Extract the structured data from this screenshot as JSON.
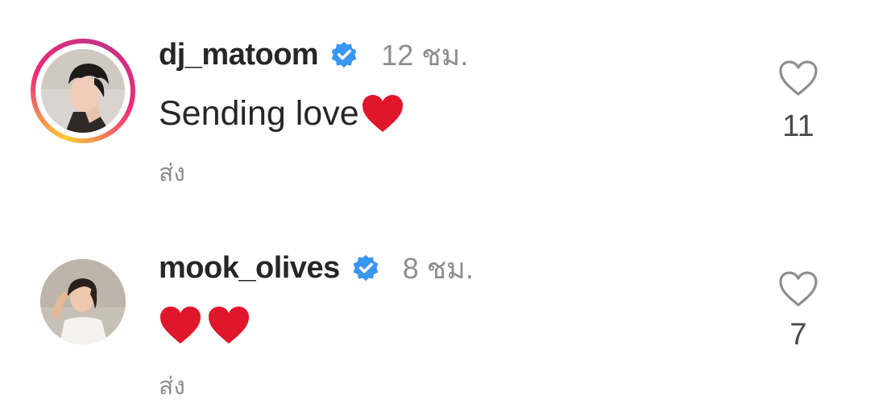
{
  "comments": [
    {
      "username": "dj_matoom",
      "time": "12 ชม.",
      "text": "Sending love",
      "reply_label": "ส่ง",
      "likes": "11",
      "avatar_icon": "user-avatar-story-ring"
    },
    {
      "username": "mook_olives",
      "time": "8 ชม.",
      "text": "",
      "reply_label": "ส่ง",
      "likes": "7",
      "avatar_icon": "user-avatar"
    }
  ],
  "colors": {
    "verified": "#3897f0",
    "heart_emoji": "#e0162b",
    "muted_text": "#8e8e8e"
  }
}
